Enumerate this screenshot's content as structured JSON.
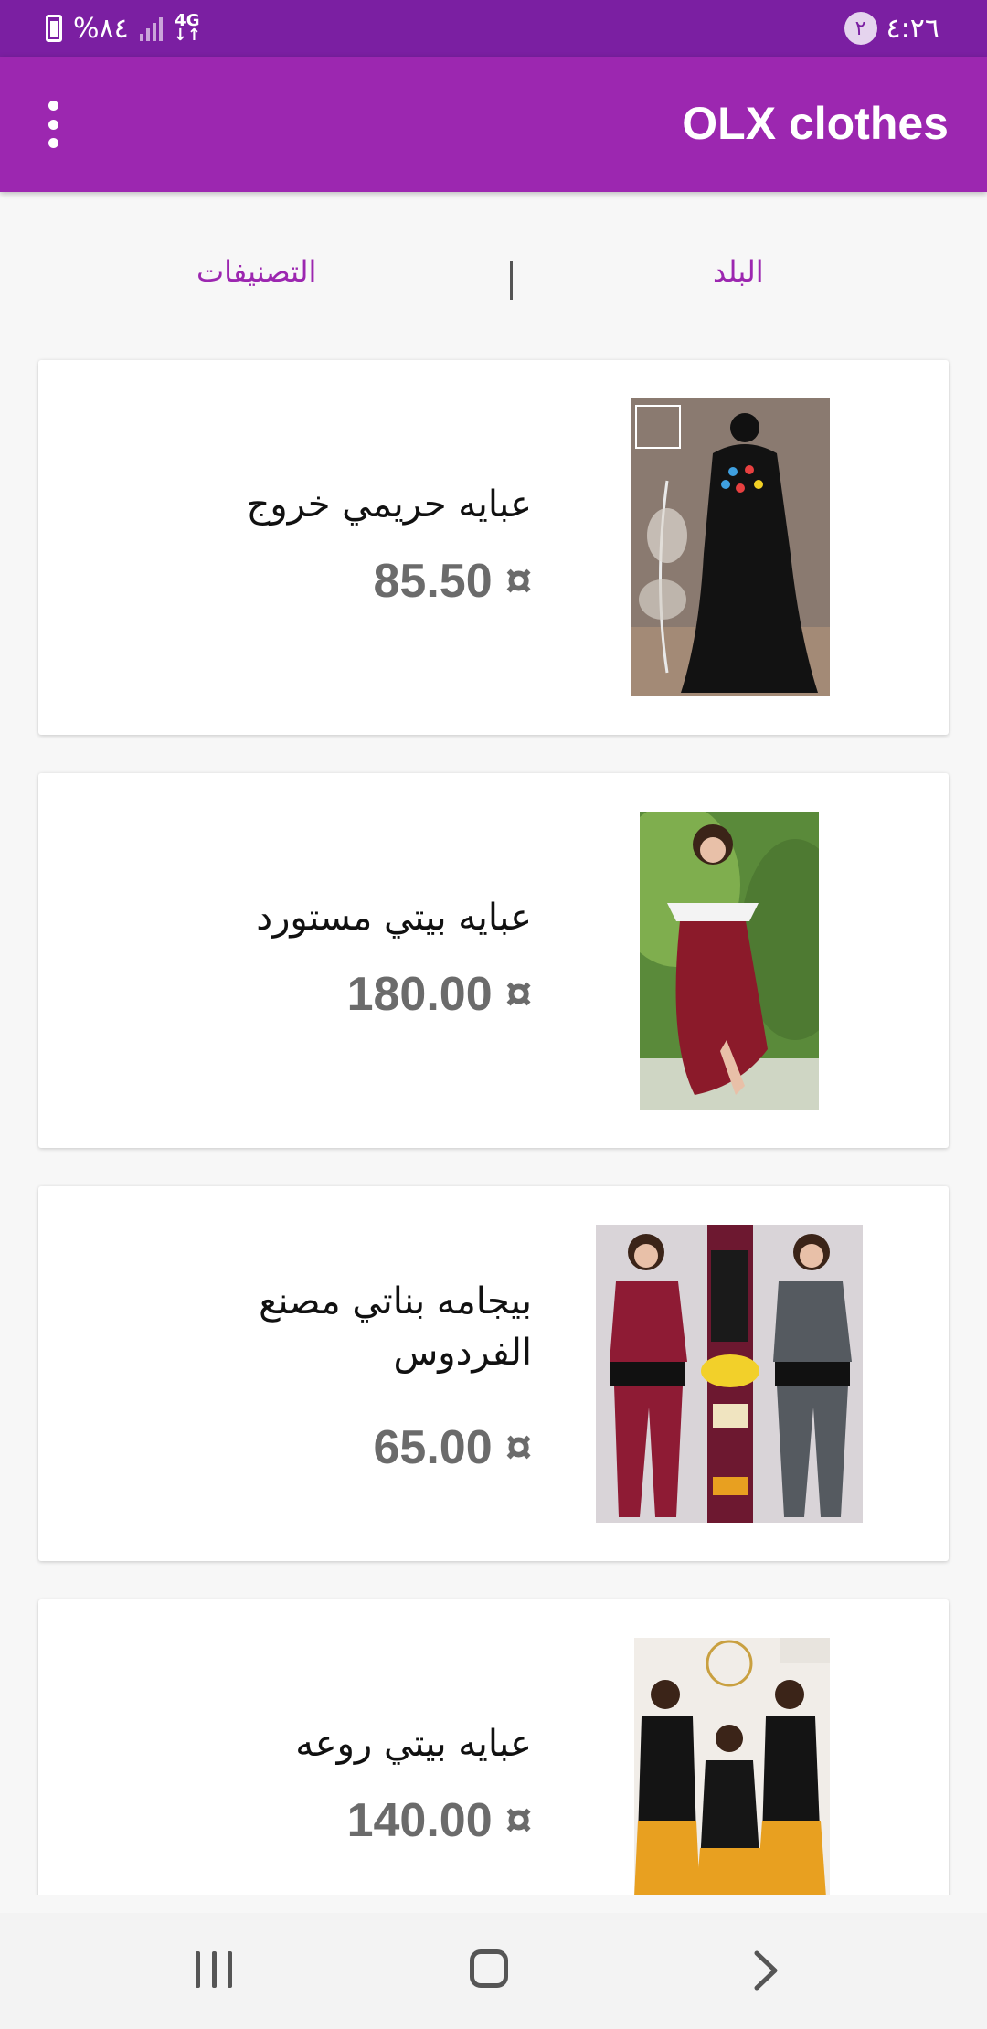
{
  "status_bar": {
    "time": "٤:٢٦",
    "notification_count": "٢",
    "battery": "%٨٤",
    "network": "4G"
  },
  "app_bar": {
    "title": "OLX clothes"
  },
  "filters": {
    "country": "البلد",
    "categories": "التصنيفات"
  },
  "products": [
    {
      "title": "عبايه حريمي خروج",
      "price": "85.50 ¤"
    },
    {
      "title": "عبايه بيتي مستورد",
      "price": "180.00 ¤"
    },
    {
      "title": "بيجامه بناتي مصنع الفردوس",
      "price": "65.00 ¤"
    },
    {
      "title": "عبايه بيتي روعه",
      "price": "140.00 ¤"
    }
  ],
  "colors": {
    "status_bar": "#7b1fa2",
    "app_bar": "#9c27b0",
    "accent": "#9c27b0",
    "price_text": "#6b6b6b"
  }
}
